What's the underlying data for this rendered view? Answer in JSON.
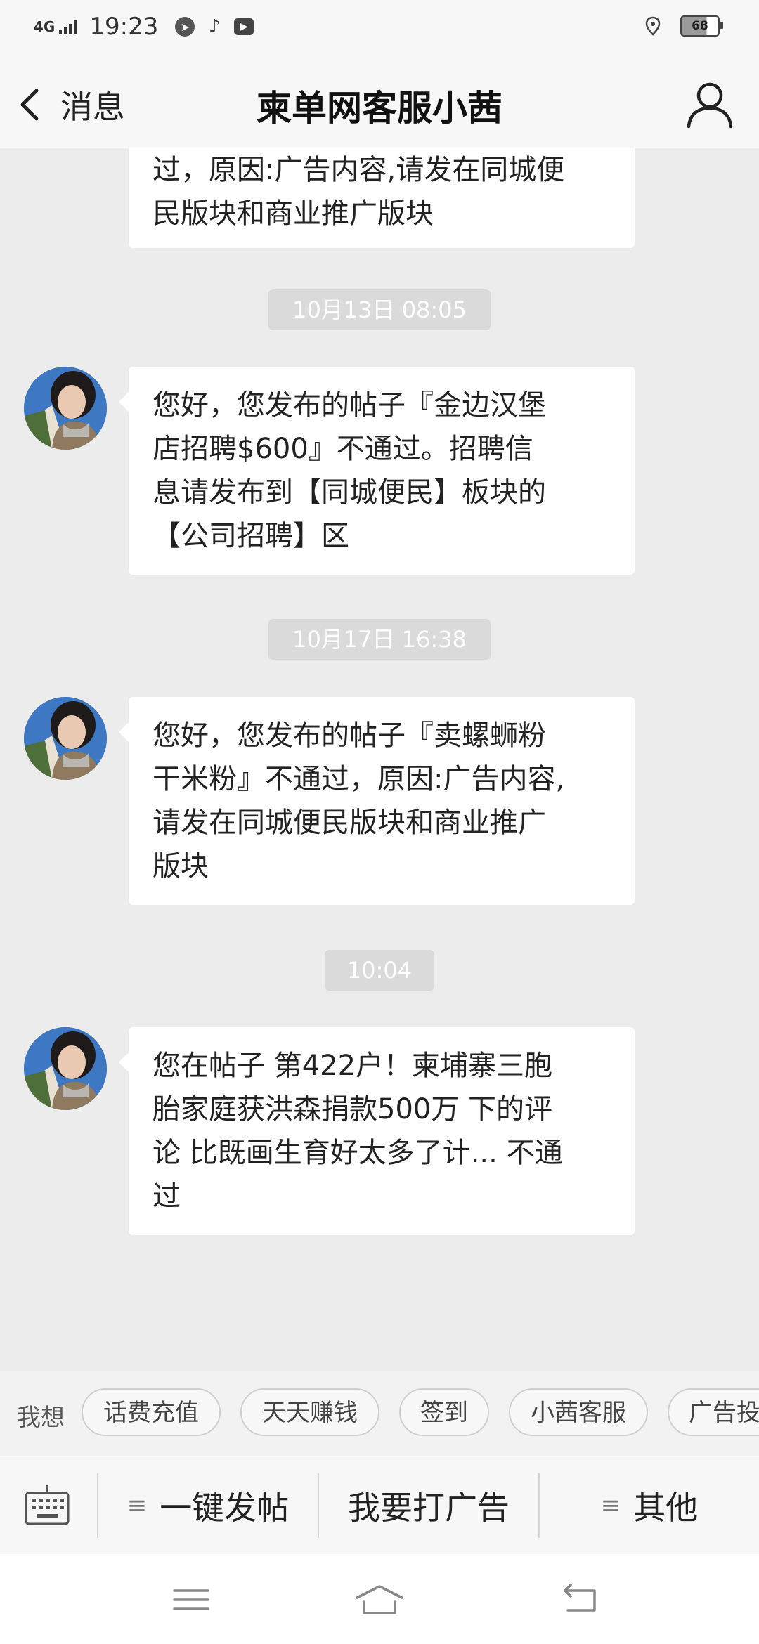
{
  "status_bar": {
    "network": "4G",
    "time": "19:23",
    "battery": "68"
  },
  "header": {
    "back_label": "消息",
    "title": "柬单网客服小茜"
  },
  "messages": [
    {
      "type": "text",
      "lines": [
        "过，原因:广告内容,请发在同城便",
        "民版块和商业推广版块"
      ]
    },
    {
      "type": "timestamp",
      "text": "10月13日 08:05"
    },
    {
      "type": "text",
      "lines": [
        "您好，您发布的帖子『金边汉堡",
        "店招聘$600』不通过。招聘信",
        "息请发布到【同城便民】板块的",
        "【公司招聘】区"
      ]
    },
    {
      "type": "timestamp",
      "text": "10月17日 16:38"
    },
    {
      "type": "text",
      "lines": [
        "您好，您发布的帖子『卖螺蛳粉",
        "干米粉』不通过，原因:广告内容,",
        "请发在同城便民版块和商业推广",
        "版块"
      ]
    },
    {
      "type": "timestamp",
      "text": "10:04"
    },
    {
      "type": "text",
      "lines": [
        "您在帖子 第422户！柬埔寨三胞",
        "胎家庭获洪森捐款500万 下的评",
        "论 比既画生育好太多了计... 不通",
        "过"
      ]
    }
  ],
  "quick_replies": {
    "label": "我想",
    "items": [
      "话费充值",
      "天天赚钱",
      "签到",
      "小茜客服",
      "广告投"
    ]
  },
  "menu": {
    "items": [
      "一键发帖",
      "我要打广告",
      "其他"
    ]
  },
  "icons": {
    "back": "chevron-left-icon",
    "profile": "person-icon",
    "keyboard": "keyboard-icon",
    "menu": "hamburger-icon",
    "home": "home-icon",
    "return": "return-icon"
  },
  "colors": {
    "background": "#ececec",
    "bubble": "#ffffff",
    "timestamp_bg": "#dadada"
  }
}
